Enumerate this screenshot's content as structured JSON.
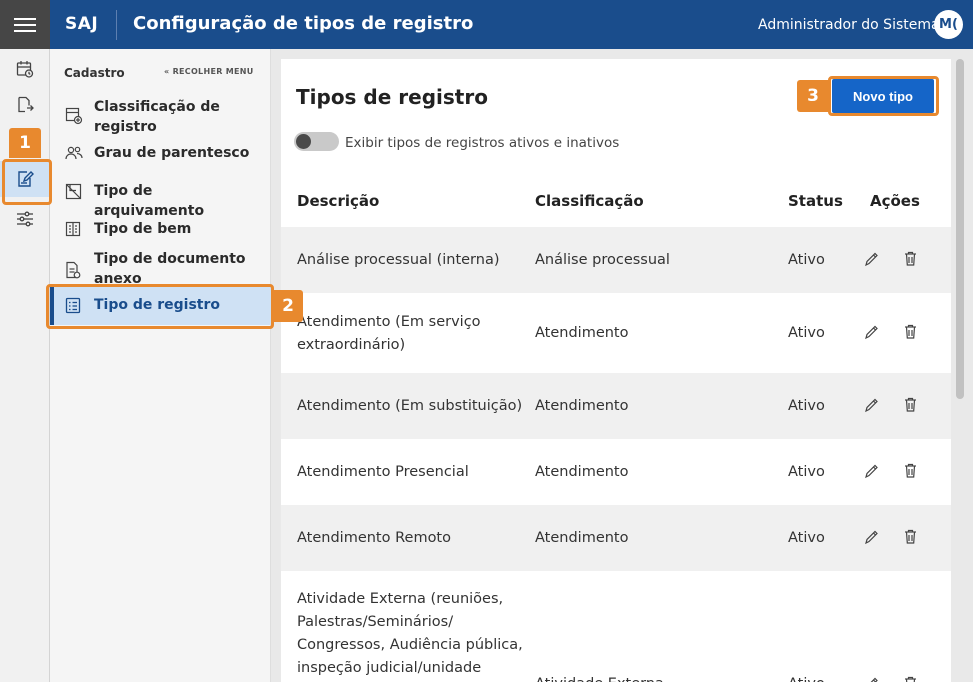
{
  "header": {
    "brand": "SAJ",
    "title": "Configuração de tipos de registro",
    "user": "Administrador do Sistema",
    "avatar_initials": "M("
  },
  "rail": {
    "icons": [
      "calendar-clock-icon",
      "document-forward-icon",
      "edit-document-icon",
      "sliders-icon"
    ],
    "active_index": 2
  },
  "sidebar": {
    "heading": "Cadastro",
    "collapse_label": "RECOLHER MENU",
    "items": [
      {
        "label": "Classificação de registro",
        "icon": "classification-icon"
      },
      {
        "label": "Grau de parentesco",
        "icon": "people-icon"
      },
      {
        "label": "Tipo de arquivamento",
        "icon": "archive-icon"
      },
      {
        "label": "Tipo de bem",
        "icon": "building-icon"
      },
      {
        "label": "Tipo de documento anexo",
        "icon": "attachment-document-icon"
      },
      {
        "label": "Tipo de registro",
        "icon": "checklist-icon",
        "active": true
      }
    ]
  },
  "main": {
    "title": "Tipos de registro",
    "new_button": "Novo tipo",
    "toggle_label": "Exibir tipos de registros ativos e inativos",
    "toggle_on": false,
    "columns": [
      "Descrição",
      "Classificação",
      "Status",
      "Ações"
    ],
    "rows": [
      {
        "descricao": "Análise processual (interna)",
        "classificacao": "Análise processual",
        "status": "Ativo"
      },
      {
        "descricao": "Atendimento (Em serviço extraordinário)",
        "classificacao": "Atendimento",
        "status": "Ativo"
      },
      {
        "descricao": "Atendimento (Em substituição)",
        "classificacao": "Atendimento",
        "status": "Ativo"
      },
      {
        "descricao": "Atendimento Presencial",
        "classificacao": "Atendimento",
        "status": "Ativo"
      },
      {
        "descricao": "Atendimento Remoto",
        "classificacao": "Atendimento",
        "status": "Ativo"
      },
      {
        "descricao": "Atividade Externa (reuniões, Palestras/Seminários/ Congressos, Audiência pública, inspeção judicial/unidade",
        "classificacao": "Atividade Externa",
        "status": "Ativo"
      }
    ]
  },
  "callouts": [
    "1",
    "2",
    "3"
  ],
  "colors": {
    "header": "#1a4d8c",
    "accent": "#1565c8",
    "callout": "#e8892e",
    "active_bg": "#cfe1f4"
  }
}
